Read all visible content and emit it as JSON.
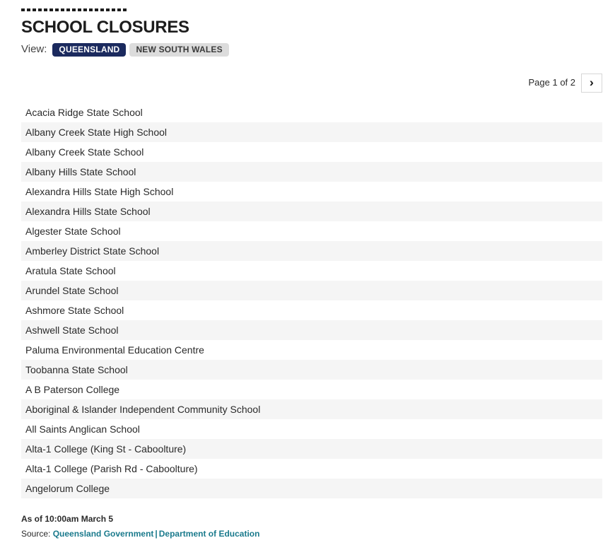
{
  "header": {
    "title": "SCHOOL CLOSURES",
    "view_label": "View:",
    "tabs": [
      {
        "label": "QUEENSLAND",
        "active": true
      },
      {
        "label": "NEW SOUTH WALES",
        "active": false
      }
    ]
  },
  "pagination": {
    "label": "Page 1 of 2",
    "next_icon": "›",
    "current_page": 1,
    "total_pages": 2
  },
  "list": {
    "items": [
      "Acacia Ridge State School",
      "Albany Creek State High School",
      "Albany Creek State School",
      "Albany Hills State School",
      "Alexandra Hills State High School",
      "Alexandra Hills State School",
      "Algester State School",
      "Amberley District State School",
      "Aratula State School",
      "Arundel State School",
      "Ashmore State School",
      "Ashwell State School",
      "Paluma Environmental Education Centre",
      "Toobanna State School",
      "A B Paterson College",
      "Aboriginal & Islander Independent Community School",
      "All Saints Anglican School",
      "Alta-1 College (King St - Caboolture)",
      "Alta-1 College (Parish Rd - Caboolture)",
      "Angelorum College"
    ]
  },
  "footer": {
    "as_of": "As of 10:00am March 5",
    "source_prefix": "Source:",
    "source_links": [
      "Queensland Government",
      "Department of Education"
    ],
    "separator": "|"
  },
  "colors": {
    "accent_navy": "#1b2a5e",
    "link_teal": "#1a7a8c",
    "inactive_pill": "#dcdcdc",
    "stripe": "#f5f5f5",
    "text": "#2a2a2a"
  }
}
